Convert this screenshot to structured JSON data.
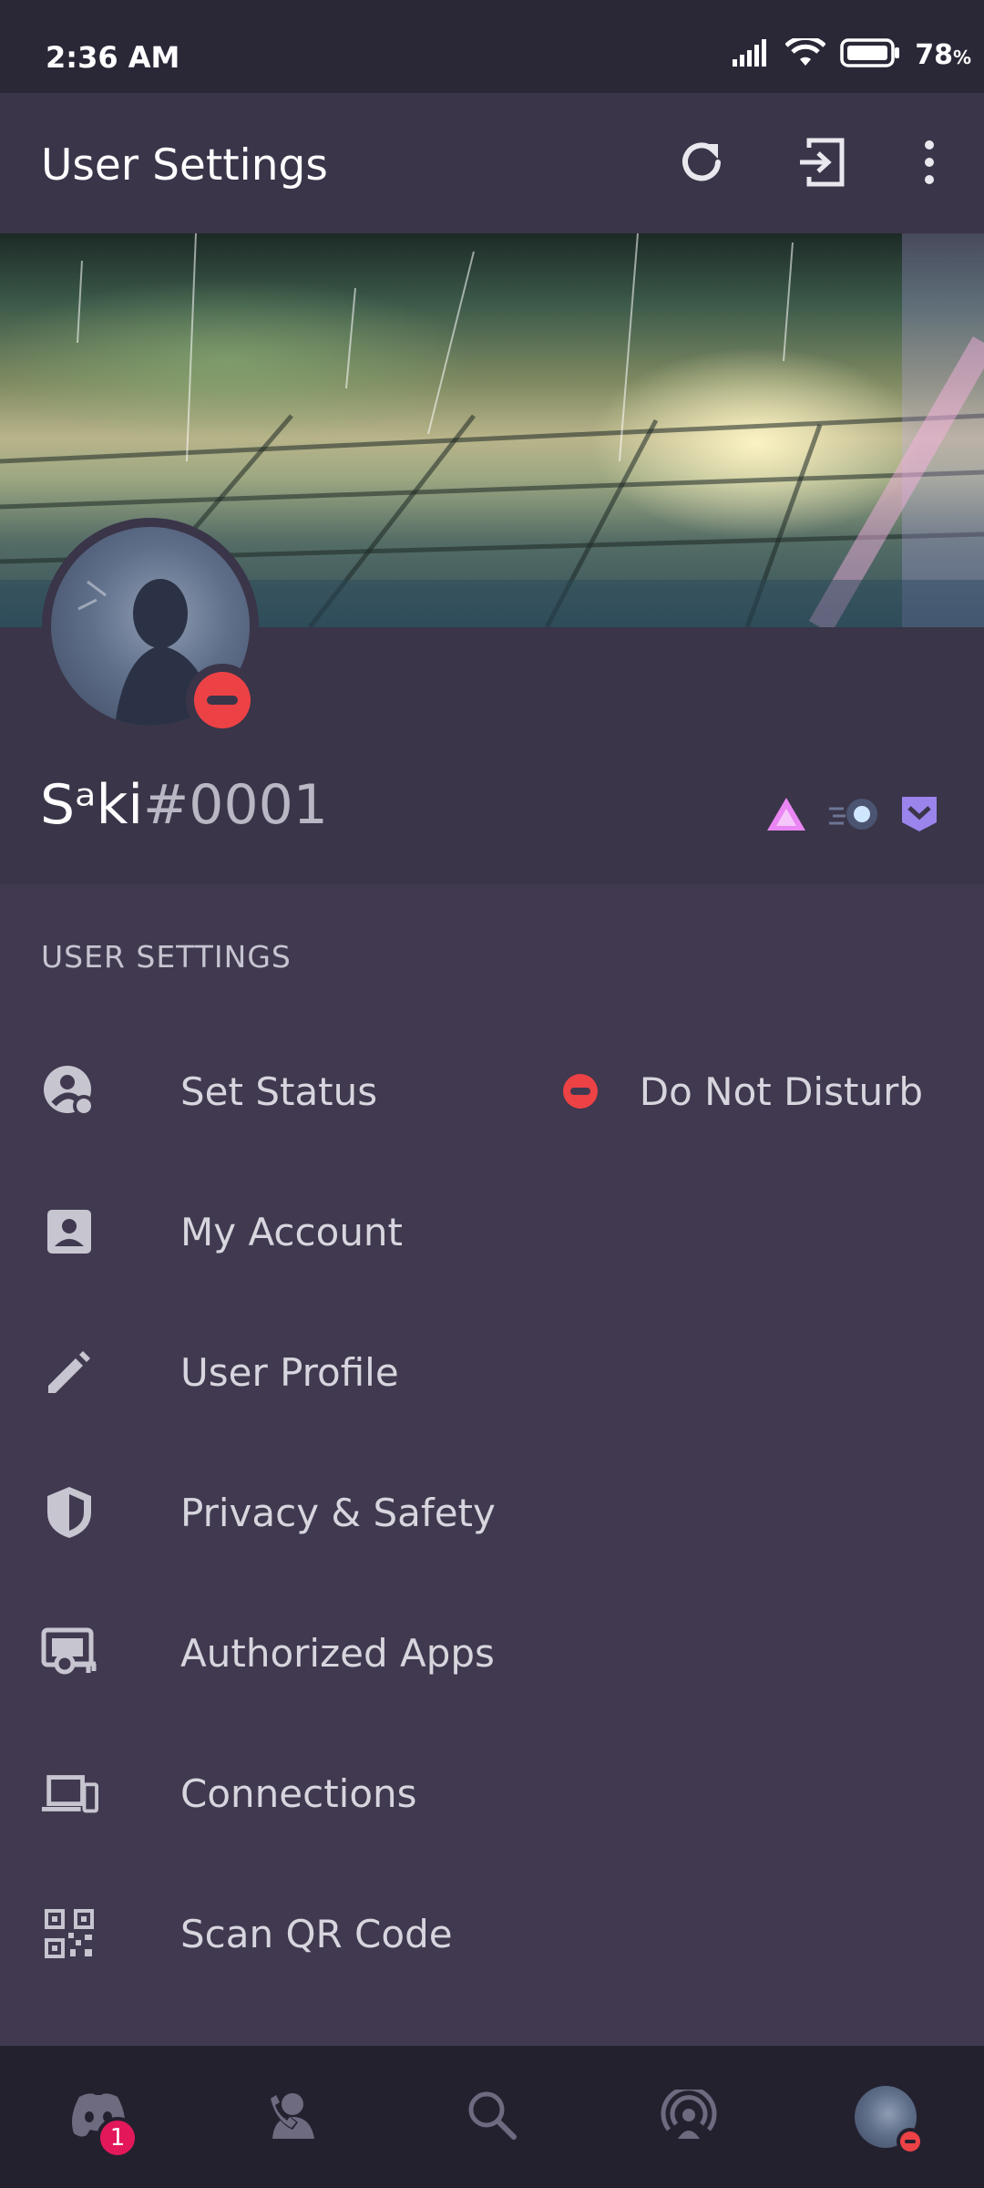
{
  "status_bar": {
    "time": "2:36 AM",
    "battery_percent": "78",
    "battery_unit": "%",
    "icons": [
      "signal-icon",
      "wifi-icon",
      "battery-icon"
    ]
  },
  "app_bar": {
    "title": "User Settings",
    "actions": [
      "refresh-icon",
      "logout-icon",
      "more-vert-icon"
    ]
  },
  "profile": {
    "username": "Sᵃki",
    "discriminator": "#0001",
    "status": "dnd",
    "badges": [
      "triangle-badge-icon",
      "speed-badge-icon",
      "chevron-shield-badge-icon"
    ]
  },
  "settings": {
    "section_title": "USER SETTINGS",
    "items": [
      {
        "label": "Set Status",
        "icon": "account-status-icon",
        "value": "Do Not Disturb"
      },
      {
        "label": "My Account",
        "icon": "account-box-icon"
      },
      {
        "label": "User Profile",
        "icon": "pencil-icon"
      },
      {
        "label": "Privacy & Safety",
        "icon": "shield-icon"
      },
      {
        "label": "Authorized Apps",
        "icon": "authorized-apps-icon"
      },
      {
        "label": "Connections",
        "icon": "devices-icon"
      },
      {
        "label": "Scan QR Code",
        "icon": "qr-code-icon"
      }
    ]
  },
  "bottom_nav": {
    "items": [
      "discord-home-icon",
      "friends-icon",
      "search-icon",
      "mentions-icon",
      "profile-avatar"
    ],
    "home_badge": "1"
  },
  "colors": {
    "background": "#40394f",
    "header": "#3a3549",
    "nav": "#24212f",
    "dnd": "#ed4245",
    "badge": "#e2185b"
  }
}
